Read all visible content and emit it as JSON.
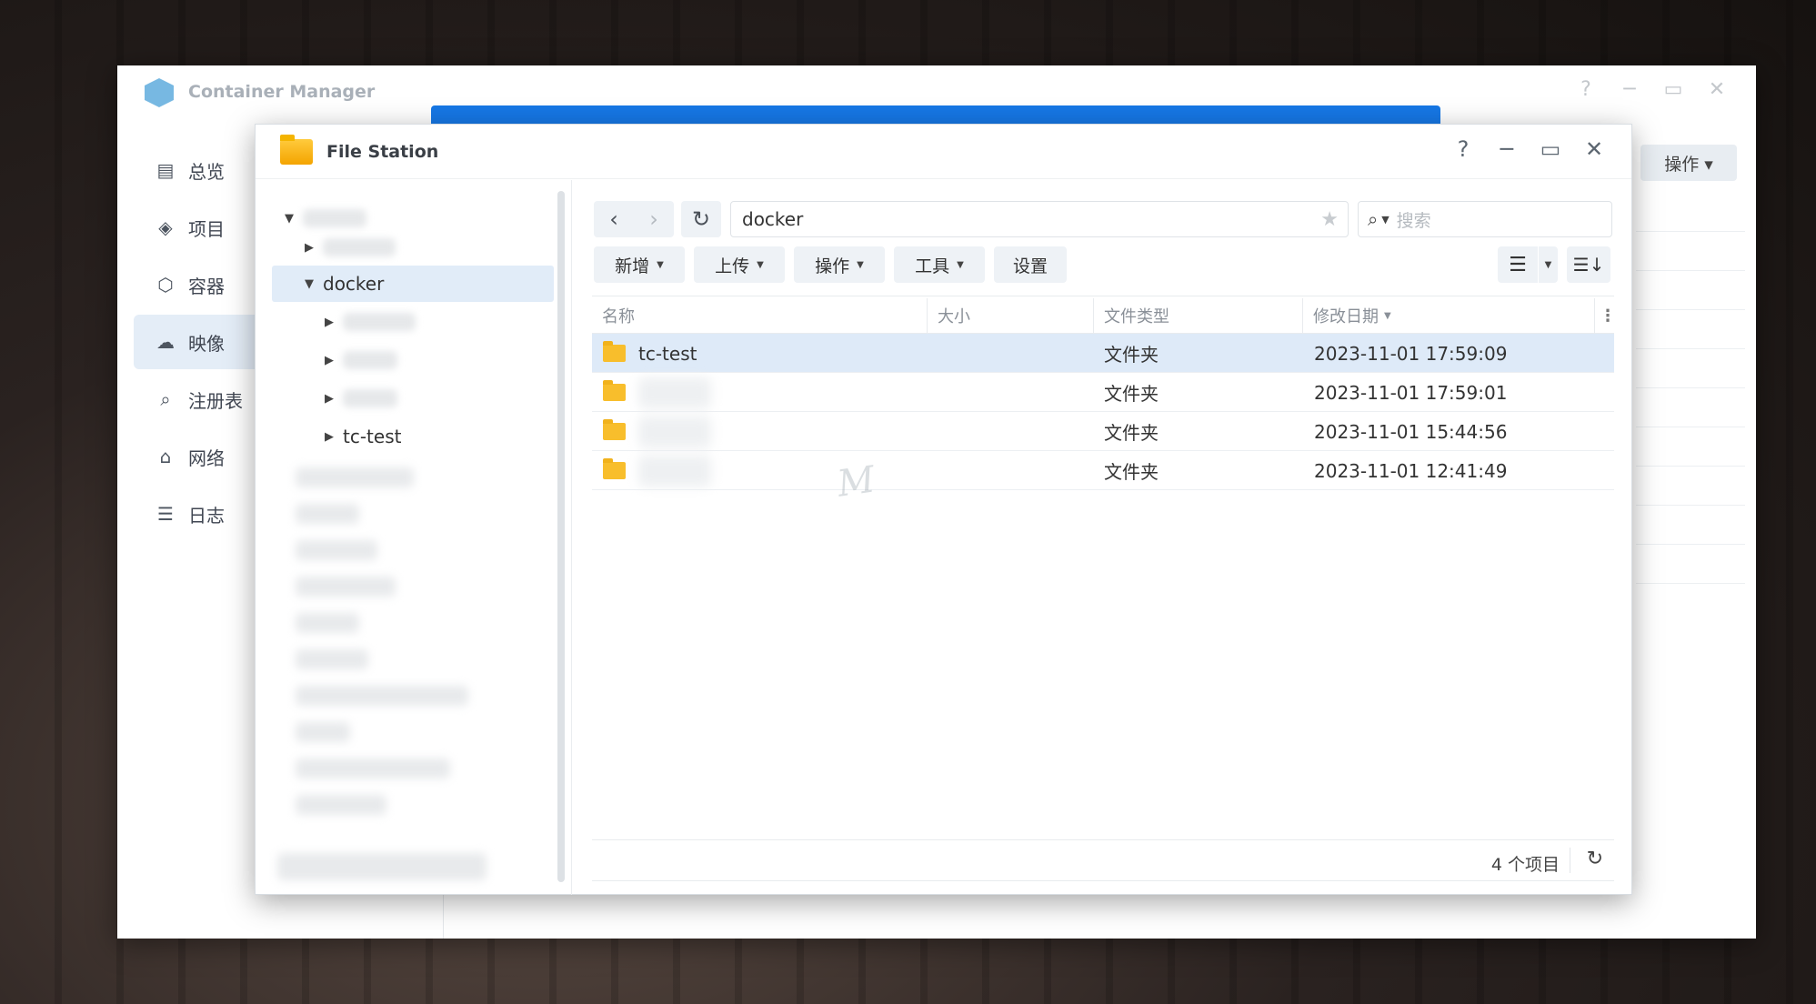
{
  "container_manager": {
    "title": "Container Manager",
    "controls": {
      "help": "?",
      "minimize": "─",
      "maximize": "▭",
      "close": "✕"
    },
    "nav": [
      {
        "label": "总览",
        "icon": "dashboard-icon"
      },
      {
        "label": "项目",
        "icon": "layers-icon"
      },
      {
        "label": "容器",
        "icon": "cube-icon"
      },
      {
        "label": "映像",
        "icon": "cloud-icon"
      },
      {
        "label": "注册表",
        "icon": "registry-search-icon"
      },
      {
        "label": "网络",
        "icon": "network-home-icon"
      },
      {
        "label": "日志",
        "icon": "list-icon"
      }
    ],
    "active_nav": "映像",
    "action_button": "操作 ▾"
  },
  "file_station": {
    "title": "File Station",
    "controls": {
      "help": "?",
      "minimize": "─",
      "maximize": "▭",
      "close": "✕"
    },
    "tree": {
      "selected": "docker",
      "child_visible": "tc-test"
    },
    "toolbar": {
      "back": "‹",
      "forward": "›",
      "refresh": "↻",
      "path": "docker",
      "search_placeholder": "搜索",
      "buttons": [
        "新增",
        "上传",
        "操作",
        "工具",
        "设置"
      ]
    },
    "table": {
      "columns": [
        "名称",
        "大小",
        "文件类型",
        "修改日期"
      ],
      "rows": [
        {
          "name": "tc-test",
          "size": "",
          "type": "文件夹",
          "modified": "2023-11-01 17:59:09",
          "selected": true
        },
        {
          "name": "",
          "size": "",
          "type": "文件夹",
          "modified": "2023-11-01 17:59:01"
        },
        {
          "name": "",
          "size": "",
          "type": "文件夹",
          "modified": "2023-11-01 15:44:56"
        },
        {
          "name": "",
          "size": "",
          "type": "文件夹",
          "modified": "2023-11-01 12:41:49"
        }
      ]
    },
    "footer": {
      "count": "4 个项目"
    }
  },
  "colors": {
    "accent_blue": "#1677e5",
    "selection": "#deeaf8",
    "folder": "#f8be2c"
  }
}
